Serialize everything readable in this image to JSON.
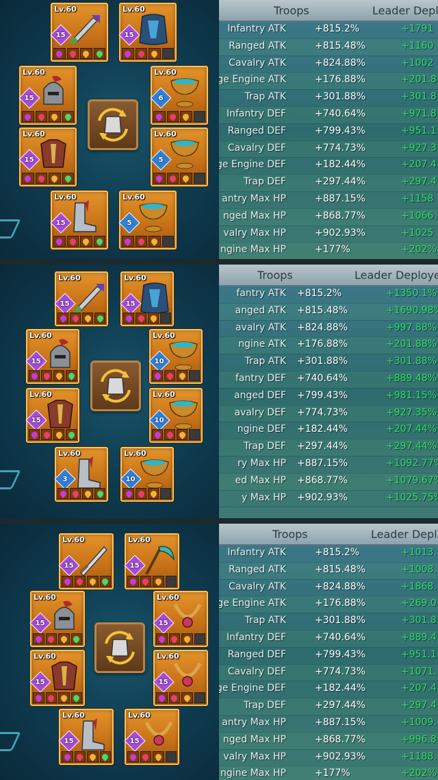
{
  "colors": {
    "bonus_green": "#2ee06a",
    "slot_orange": "#d9852a",
    "table_teal": "#2e6b6e"
  },
  "panels": [
    {
      "headers": {
        "troops": "Troops",
        "leader": "Leader Depl"
      },
      "rows": [
        {
          "label": "Infantry ATK",
          "troops": "+815.2%",
          "leader": "+1791"
        },
        {
          "label": "Ranged ATK",
          "troops": "+815.48%",
          "leader": "+1160"
        },
        {
          "label": "Cavalry ATK",
          "troops": "+824.88%",
          "leader": "+1002"
        },
        {
          "label": "ge Engine ATK",
          "troops": "+176.88%",
          "leader": "+201.8"
        },
        {
          "label": "Trap ATK",
          "troops": "+301.88%",
          "leader": "+301.8"
        },
        {
          "label": "Infantry DEF",
          "troops": "+740.64%",
          "leader": "+971.8"
        },
        {
          "label": "Ranged DEF",
          "troops": "+799.43%",
          "leader": "+951.1"
        },
        {
          "label": "Cavalry DEF",
          "troops": "+774.73%",
          "leader": "+927.3"
        },
        {
          "label": "ge Engine DEF",
          "troops": "+182.44%",
          "leader": "+207.4"
        },
        {
          "label": "Trap DEF",
          "troops": "+297.44%",
          "leader": "+297.4"
        },
        {
          "label": "antry Max HP",
          "troops": "+887.15%",
          "leader": "+1158"
        },
        {
          "label": "nged Max HP",
          "troops": "+868.77%",
          "leader": "+1066"
        },
        {
          "label": "valry Max HP",
          "troops": "+902.93%",
          "leader": "+1025"
        },
        {
          "label": "ngine Max HP",
          "troops": "+177%",
          "leader": "+202%"
        }
      ],
      "slots": [
        {
          "lv": "Lv.60",
          "stars": "15",
          "star_color": "purple",
          "item": "weapon-icon"
        },
        {
          "lv": "Lv.60",
          "stars": "15",
          "star_color": "purple",
          "item": "cloak-icon"
        },
        {
          "lv": "Lv.60",
          "stars": "15",
          "star_color": "purple",
          "item": "helmet-icon"
        },
        {
          "lv": "Lv.60",
          "stars": "6",
          "star_color": "blue",
          "item": "chalice-icon"
        },
        {
          "lv": "Lv.60",
          "stars": "15",
          "star_color": "purple",
          "item": "armor-icon"
        },
        {
          "lv": "Lv.60",
          "stars": "5",
          "star_color": "blue",
          "item": "chalice-icon"
        },
        {
          "lv": "Lv.60",
          "stars": "15",
          "star_color": "purple",
          "item": "boots-icon"
        },
        {
          "lv": "Lv.60",
          "stars": "5",
          "star_color": "blue",
          "item": "chalice-icon"
        }
      ]
    },
    {
      "headers": {
        "troops": "Troops",
        "leader": "Leader Deploye"
      },
      "rows": [
        {
          "label": "fantry ATK",
          "troops": "+815.2%",
          "leader": "+1350.1%"
        },
        {
          "label": "anged ATK",
          "troops": "+815.48%",
          "leader": "+1690.98%"
        },
        {
          "label": "avalry ATK",
          "troops": "+824.88%",
          "leader": "+997.88%"
        },
        {
          "label": "ngine ATK",
          "troops": "+176.88%",
          "leader": "+201.88%"
        },
        {
          "label": "Trap ATK",
          "troops": "+301.88%",
          "leader": "+301.88%"
        },
        {
          "label": "fantry DEF",
          "troops": "+740.64%",
          "leader": "+889.48%"
        },
        {
          "label": "anged DEF",
          "troops": "+799.43%",
          "leader": "+981.15%"
        },
        {
          "label": "avalry DEF",
          "troops": "+774.73%",
          "leader": "+927.35%"
        },
        {
          "label": "ngine DEF",
          "troops": "+182.44%",
          "leader": "+207.44%"
        },
        {
          "label": "Trap DEF",
          "troops": "+297.44%",
          "leader": "+297.44%"
        },
        {
          "label": "ry Max HP",
          "troops": "+887.15%",
          "leader": "+1092.77%"
        },
        {
          "label": "ed Max HP",
          "troops": "+868.77%",
          "leader": "+1079.67%"
        },
        {
          "label": "y Max HP",
          "troops": "+902.93%",
          "leader": "+1025.75%"
        }
      ],
      "slots": [
        {
          "lv": "Lv.60",
          "stars": "15",
          "star_color": "purple",
          "item": "weapon-icon"
        },
        {
          "lv": "Lv.60",
          "stars": "15",
          "star_color": "purple",
          "item": "cloak-icon"
        },
        {
          "lv": "Lv.60",
          "stars": "15",
          "star_color": "purple",
          "item": "helmet-icon"
        },
        {
          "lv": "Lv.60",
          "stars": "10",
          "star_color": "blue",
          "item": "chalice-icon"
        },
        {
          "lv": "Lv.60",
          "stars": "15",
          "star_color": "purple",
          "item": "armor-icon"
        },
        {
          "lv": "Lv.60",
          "stars": "10",
          "star_color": "blue",
          "item": "chalice-icon"
        },
        {
          "lv": "Lv.60",
          "stars": "3",
          "star_color": "blue",
          "item": "boots-icon"
        },
        {
          "lv": "Lv.60",
          "stars": "10",
          "star_color": "blue",
          "item": "chalice-icon"
        }
      ]
    },
    {
      "headers": {
        "troops": "Troops",
        "leader": "Leader Depl"
      },
      "rows": [
        {
          "label": "Infantry ATK",
          "troops": "+815.2%",
          "leader": "+1013."
        },
        {
          "label": "Ranged ATK",
          "troops": "+815.48%",
          "leader": "+1008."
        },
        {
          "label": "Cavalry ATK",
          "troops": "+824.88%",
          "leader": "+1868."
        },
        {
          "label": "ge Engine ATK",
          "troops": "+176.88%",
          "leader": "+269.0"
        },
        {
          "label": "Trap ATK",
          "troops": "+301.88%",
          "leader": "+301.8"
        },
        {
          "label": "Infantry DEF",
          "troops": "+740.64%",
          "leader": "+889.4"
        },
        {
          "label": "Ranged DEF",
          "troops": "+799.43%",
          "leader": "+951.1"
        },
        {
          "label": "Cavalry DEF",
          "troops": "+774.73%",
          "leader": "+1071."
        },
        {
          "label": "ge Engine DEF",
          "troops": "+182.44%",
          "leader": "+207.4"
        },
        {
          "label": "Trap DEF",
          "troops": "+297.44%",
          "leader": "+297.4"
        },
        {
          "label": "antry Max HP",
          "troops": "+887.15%",
          "leader": "+1009."
        },
        {
          "label": "nged Max HP",
          "troops": "+868.77%",
          "leader": "+996.8"
        },
        {
          "label": "valry Max HP",
          "troops": "+902.93%",
          "leader": "+1188."
        },
        {
          "label": "ngine Max HP",
          "troops": "+177%",
          "leader": "+202%"
        }
      ],
      "slots": [
        {
          "lv": "Lv.60",
          "stars": "15",
          "star_color": "purple",
          "item": "sword-icon"
        },
        {
          "lv": "Lv.60",
          "stars": "15",
          "star_color": "purple",
          "item": "scythe-icon"
        },
        {
          "lv": "Lv.60",
          "stars": "15",
          "star_color": "purple",
          "item": "helmet-icon"
        },
        {
          "lv": "Lv.60",
          "stars": "15",
          "star_color": "purple",
          "item": "necklace-icon"
        },
        {
          "lv": "Lv.60",
          "stars": "15",
          "star_color": "purple",
          "item": "armor-icon"
        },
        {
          "lv": "Lv.60",
          "stars": "15",
          "star_color": "purple",
          "item": "necklace-icon"
        },
        {
          "lv": "Lv.60",
          "stars": "15",
          "star_color": "purple",
          "item": "boots-icon"
        },
        {
          "lv": "Lv.60",
          "stars": "15",
          "star_color": "purple",
          "item": "necklace-icon"
        }
      ]
    }
  ]
}
